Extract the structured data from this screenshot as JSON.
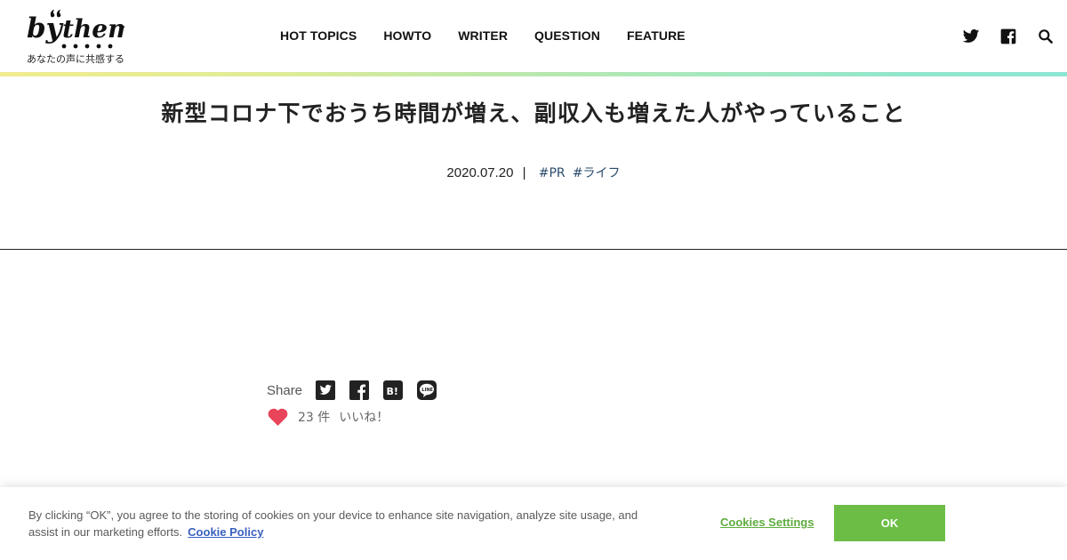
{
  "header": {
    "logo_text": "by them",
    "tagline": "あなたの声に共感する",
    "nav": [
      "HOT TOPICS",
      "HOWTO",
      "WRITER",
      "QUESTION",
      "FEATURE"
    ],
    "icons": [
      "twitter-icon",
      "facebook-icon",
      "search-icon"
    ],
    "gradient_colors": [
      "#f1ec8f",
      "#8de6d4"
    ]
  },
  "article": {
    "title": "新型コロナ下でおうち時間が増え、副収入も増えた人がやっていること",
    "date": "2020.07.20",
    "separator": "|",
    "tags": [
      "#PR",
      "#ライフ"
    ]
  },
  "share": {
    "label": "Share",
    "icons": [
      "twitter-share-icon",
      "facebook-share-icon",
      "hatena-bookmark-icon",
      "line-icon"
    ],
    "like_count": "23 件",
    "like_label": "いいね！",
    "heart_color": "#e8445a"
  },
  "cookie_banner": {
    "text": "By clicking “OK”, you agree to the storing of cookies on your device to enhance site navigation, analyze site usage, and assist in our marketing efforts.",
    "policy_link": "Cookie Policy",
    "settings_label": "Cookies Settings",
    "ok_label": "OK",
    "accent_color": "#6cbd45"
  }
}
